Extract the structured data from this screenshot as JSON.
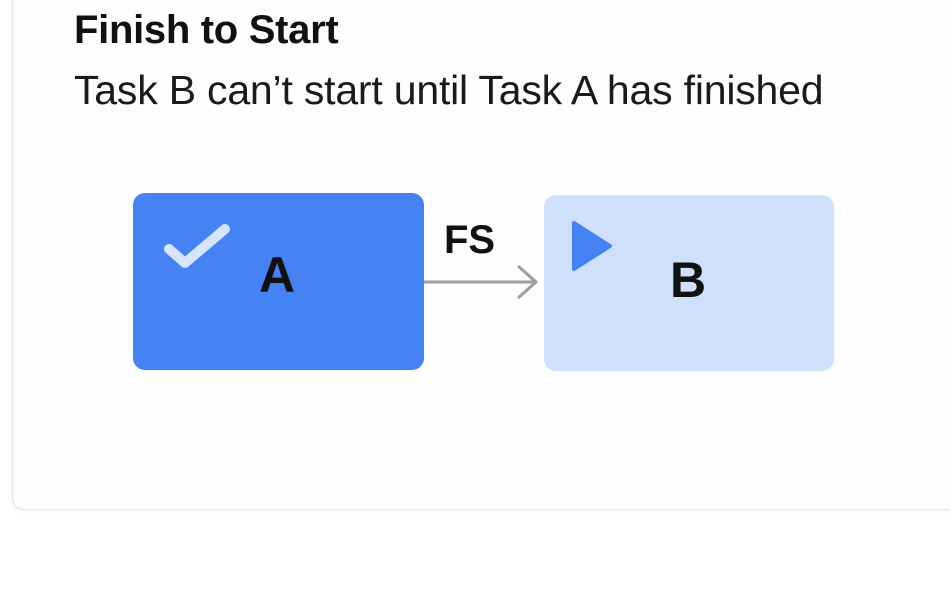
{
  "card": {
    "title": "Finish to Start",
    "subtitle": "Task B can’t start until Task A has finished"
  },
  "diagram": {
    "task_a": {
      "label": "A",
      "icon": "check-icon",
      "color": "#4582f3"
    },
    "task_b": {
      "label": "B",
      "icon": "play-icon",
      "color": "#cfe0fb"
    },
    "link": {
      "label": "FS",
      "color": "#9e9e9e"
    }
  }
}
